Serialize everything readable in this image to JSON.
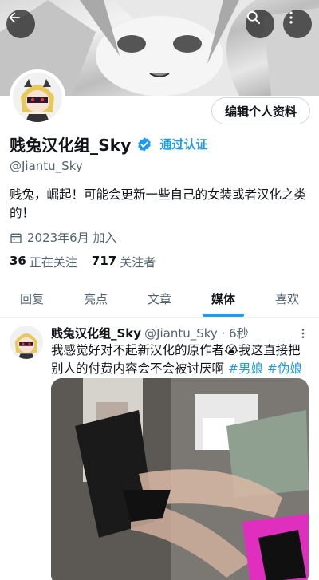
{
  "header": {
    "back_icon": "arrow-left-icon",
    "search_icon": "search-icon",
    "more_icon": "more-vertical-icon"
  },
  "profile": {
    "display_name": "贱兔汉化组_Sky",
    "verify_label": "通过认证",
    "handle": "@Jiantu_Sky",
    "bio": "贱兔，崛起！可能会更新一些自己的女装或者汉化之类的！",
    "joined": "2023年6月 加入",
    "edit_button": "编辑个人资料",
    "following_count": "36",
    "following_label": "正在关注",
    "followers_count": "717",
    "followers_label": "关注者"
  },
  "tabs": [
    {
      "label": "回复",
      "active": false
    },
    {
      "label": "亮点",
      "active": false
    },
    {
      "label": "文章",
      "active": false
    },
    {
      "label": "媒体",
      "active": true
    },
    {
      "label": "喜欢",
      "active": false
    }
  ],
  "post": {
    "name": "贱兔汉化组_Sky",
    "handle_time": "@Jiantu_Sky · 6秒",
    "text": "我感觉好对不起新汉化的原作者😭我这直接把别人的付费内容会不会被讨厌啊",
    "hashtag1": "#男娘",
    "hashtag2": "#伪娘"
  },
  "colors": {
    "accent": "#1d9bf0",
    "text": "#0f1419",
    "secondary": "#536471"
  }
}
